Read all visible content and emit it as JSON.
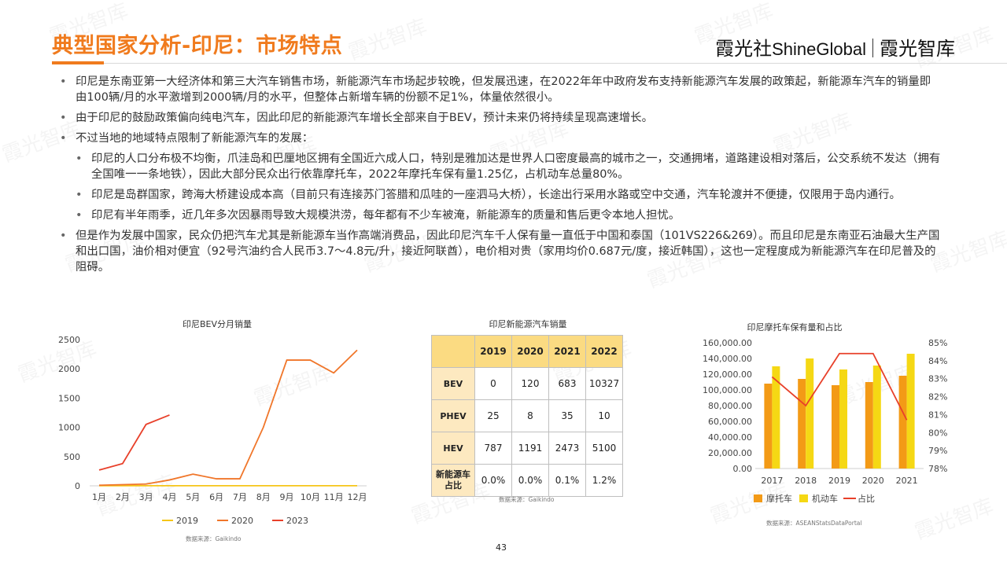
{
  "header": {
    "title": "典型国家分析-印尼：市场特点",
    "brand_cn": "霞光社",
    "brand_en": "ShineGlobal",
    "brand_right": "霞光智库"
  },
  "bullets": [
    {
      "level": 1,
      "text": "印尼是东南亚第一大经济体和第三大汽车销售市场，新能源汽车市场起步较晚，但发展迅速，在2022年年中政府发布支持新能源汽车发展的政策起，新能源车汽车的销量即由100辆/月的水平激增到2000辆/月的水平，但整体占新增车辆的份额不足1%，体量依然很小。"
    },
    {
      "level": 1,
      "text": "由于印尼的鼓励政策偏向纯电汽车，因此印尼的新能源汽车增长全部来自于BEV，预计未来仍将持续呈现高速增长。"
    },
    {
      "level": 1,
      "text": "不过当地的地域特点限制了新能源汽车的发展："
    },
    {
      "level": 2,
      "text": "印尼的人口分布极不均衡，爪洼岛和巴厘地区拥有全国近六成人口，特别是雅加达是世界人口密度最高的城市之一，交通拥堵，道路建设相对落后，公交系统不发达（拥有全国唯一一条地铁），因此大部分民众出行依靠摩托车，2022年摩托车保有量1.25亿，占机动车总量80%。"
    },
    {
      "level": 2,
      "text": "印尼是岛群国家，跨海大桥建设成本高（目前只有连接苏门答腊和瓜哇的一座泗马大桥），长途出行采用水路或空中交通，汽车轮渡并不便捷，仅限用于岛内通行。"
    },
    {
      "level": 2,
      "text": "印尼有半年雨季，近几年多次因暴雨导致大规模洪涝，每年都有不少车被淹，新能源车的质量和售后更令本地人担忧。"
    },
    {
      "level": 1,
      "text": "但是作为发展中国家，民众仍把汽车尤其是新能源车当作高端消费品，因此印尼汽车千人保有量一直低于中国和泰国（101VS226&269）。而且印尼是东南亚石油最大生产国和出口国，油价相对便宜（92号汽油约合人民币3.7～4.8元/升，接近阿联酋），电价相对贵（家用均价0.687元/度，接近韩国），这也一定程度成为新能源汽车在印尼普及的阻碍。"
    }
  ],
  "chart_data": [
    {
      "type": "line",
      "title": "印尼BEV分月销量",
      "categories": [
        "1月",
        "2月",
        "3月",
        "4月",
        "5月",
        "6月",
        "7月",
        "8月",
        "9月",
        "10月",
        "11月",
        "12月"
      ],
      "yticks": [
        "0",
        "500",
        "1000",
        "1500",
        "2000",
        "2500"
      ],
      "ylim": [
        0,
        2500
      ],
      "series": [
        {
          "name": "2019",
          "color": "#f5c518",
          "values": [
            2,
            2,
            2,
            2,
            2,
            2,
            2,
            2,
            2,
            2,
            2,
            2
          ]
        },
        {
          "name": "2020",
          "color": "#f0762a",
          "values": [
            10,
            20,
            30,
            100,
            200,
            120,
            120,
            1000,
            2150,
            2150,
            1930,
            2320
          ]
        },
        {
          "name": "2023",
          "color": "#e8402a",
          "values": [
            270,
            380,
            1050,
            1210
          ]
        }
      ],
      "legend": "bottom",
      "source": "数据来源：Gaikindo"
    },
    {
      "type": "table",
      "title": "印尼新能源汽车销量",
      "columns": [
        "2019",
        "2020",
        "2021",
        "2022"
      ],
      "rows": [
        {
          "label": "BEV",
          "values": [
            "0",
            "120",
            "683",
            "10327"
          ]
        },
        {
          "label": "PHEV",
          "values": [
            "25",
            "8",
            "35",
            "10"
          ]
        },
        {
          "label": "HEV",
          "values": [
            "787",
            "1191",
            "2473",
            "5100"
          ]
        },
        {
          "label": "新能源车占比",
          "values": [
            "0.0%",
            "0.0%",
            "0.1%",
            "1.2%"
          ]
        }
      ],
      "source": "数据来源：Gaikindo"
    },
    {
      "type": "bar",
      "title": "印尼摩托车保有量和占比",
      "categories": [
        "2017",
        "2018",
        "2019",
        "2020",
        "2021"
      ],
      "yticks": [
        "0.00",
        "20,000.00",
        "40,000.00",
        "60,000.00",
        "80,000.00",
        "100,000.00",
        "120,000.00",
        "140,000.00",
        "160,000.00"
      ],
      "ylim": [
        0,
        160000
      ],
      "y2ticks": [
        "78%",
        "79%",
        "80%",
        "81%",
        "82%",
        "83%",
        "84%",
        "85%"
      ],
      "y2lim": [
        78,
        85
      ],
      "series": [
        {
          "name": "摩托车",
          "kind": "bar",
          "color": "#f39a16",
          "values": [
            108000,
            114000,
            106000,
            110000,
            118000
          ]
        },
        {
          "name": "机动车",
          "kind": "bar",
          "color": "#f5d814",
          "values": [
            130000,
            140000,
            126000,
            131000,
            146000
          ]
        },
        {
          "name": "占比",
          "kind": "line",
          "axis": "right",
          "color": "#e8402a",
          "values": [
            83.1,
            81.5,
            84.4,
            84.4,
            80.7
          ]
        }
      ],
      "legend": "bottom",
      "source": "数据来源：ASEANStatsDataPortal"
    }
  ],
  "page_number": "43",
  "watermark": "霞光智库"
}
